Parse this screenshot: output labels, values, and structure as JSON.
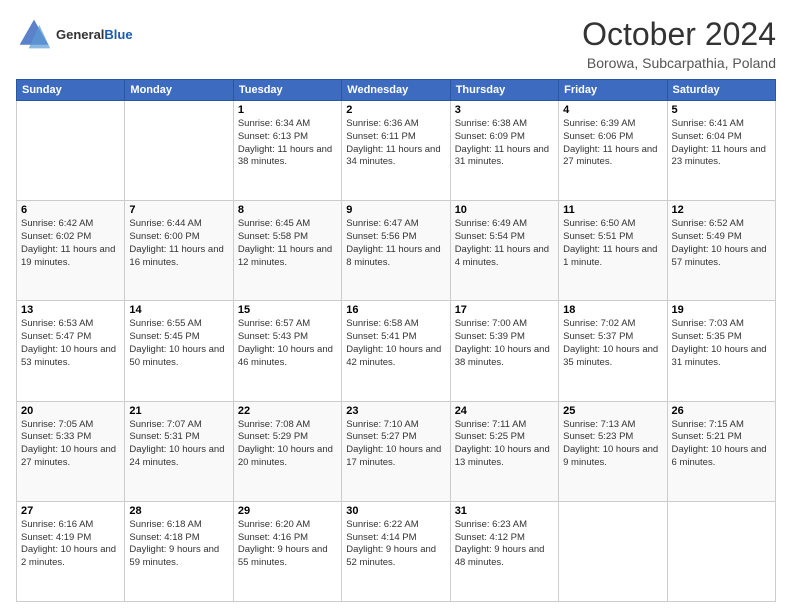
{
  "header": {
    "logo_general": "General",
    "logo_blue": "Blue",
    "month": "October 2024",
    "location": "Borowa, Subcarpathia, Poland"
  },
  "days_of_week": [
    "Sunday",
    "Monday",
    "Tuesday",
    "Wednesday",
    "Thursday",
    "Friday",
    "Saturday"
  ],
  "weeks": [
    [
      {
        "day": "",
        "sunrise": "",
        "sunset": "",
        "daylight": ""
      },
      {
        "day": "",
        "sunrise": "",
        "sunset": "",
        "daylight": ""
      },
      {
        "day": "1",
        "sunrise": "Sunrise: 6:34 AM",
        "sunset": "Sunset: 6:13 PM",
        "daylight": "Daylight: 11 hours and 38 minutes."
      },
      {
        "day": "2",
        "sunrise": "Sunrise: 6:36 AM",
        "sunset": "Sunset: 6:11 PM",
        "daylight": "Daylight: 11 hours and 34 minutes."
      },
      {
        "day": "3",
        "sunrise": "Sunrise: 6:38 AM",
        "sunset": "Sunset: 6:09 PM",
        "daylight": "Daylight: 11 hours and 31 minutes."
      },
      {
        "day": "4",
        "sunrise": "Sunrise: 6:39 AM",
        "sunset": "Sunset: 6:06 PM",
        "daylight": "Daylight: 11 hours and 27 minutes."
      },
      {
        "day": "5",
        "sunrise": "Sunrise: 6:41 AM",
        "sunset": "Sunset: 6:04 PM",
        "daylight": "Daylight: 11 hours and 23 minutes."
      }
    ],
    [
      {
        "day": "6",
        "sunrise": "Sunrise: 6:42 AM",
        "sunset": "Sunset: 6:02 PM",
        "daylight": "Daylight: 11 hours and 19 minutes."
      },
      {
        "day": "7",
        "sunrise": "Sunrise: 6:44 AM",
        "sunset": "Sunset: 6:00 PM",
        "daylight": "Daylight: 11 hours and 16 minutes."
      },
      {
        "day": "8",
        "sunrise": "Sunrise: 6:45 AM",
        "sunset": "Sunset: 5:58 PM",
        "daylight": "Daylight: 11 hours and 12 minutes."
      },
      {
        "day": "9",
        "sunrise": "Sunrise: 6:47 AM",
        "sunset": "Sunset: 5:56 PM",
        "daylight": "Daylight: 11 hours and 8 minutes."
      },
      {
        "day": "10",
        "sunrise": "Sunrise: 6:49 AM",
        "sunset": "Sunset: 5:54 PM",
        "daylight": "Daylight: 11 hours and 4 minutes."
      },
      {
        "day": "11",
        "sunrise": "Sunrise: 6:50 AM",
        "sunset": "Sunset: 5:51 PM",
        "daylight": "Daylight: 11 hours and 1 minute."
      },
      {
        "day": "12",
        "sunrise": "Sunrise: 6:52 AM",
        "sunset": "Sunset: 5:49 PM",
        "daylight": "Daylight: 10 hours and 57 minutes."
      }
    ],
    [
      {
        "day": "13",
        "sunrise": "Sunrise: 6:53 AM",
        "sunset": "Sunset: 5:47 PM",
        "daylight": "Daylight: 10 hours and 53 minutes."
      },
      {
        "day": "14",
        "sunrise": "Sunrise: 6:55 AM",
        "sunset": "Sunset: 5:45 PM",
        "daylight": "Daylight: 10 hours and 50 minutes."
      },
      {
        "day": "15",
        "sunrise": "Sunrise: 6:57 AM",
        "sunset": "Sunset: 5:43 PM",
        "daylight": "Daylight: 10 hours and 46 minutes."
      },
      {
        "day": "16",
        "sunrise": "Sunrise: 6:58 AM",
        "sunset": "Sunset: 5:41 PM",
        "daylight": "Daylight: 10 hours and 42 minutes."
      },
      {
        "day": "17",
        "sunrise": "Sunrise: 7:00 AM",
        "sunset": "Sunset: 5:39 PM",
        "daylight": "Daylight: 10 hours and 38 minutes."
      },
      {
        "day": "18",
        "sunrise": "Sunrise: 7:02 AM",
        "sunset": "Sunset: 5:37 PM",
        "daylight": "Daylight: 10 hours and 35 minutes."
      },
      {
        "day": "19",
        "sunrise": "Sunrise: 7:03 AM",
        "sunset": "Sunset: 5:35 PM",
        "daylight": "Daylight: 10 hours and 31 minutes."
      }
    ],
    [
      {
        "day": "20",
        "sunrise": "Sunrise: 7:05 AM",
        "sunset": "Sunset: 5:33 PM",
        "daylight": "Daylight: 10 hours and 27 minutes."
      },
      {
        "day": "21",
        "sunrise": "Sunrise: 7:07 AM",
        "sunset": "Sunset: 5:31 PM",
        "daylight": "Daylight: 10 hours and 24 minutes."
      },
      {
        "day": "22",
        "sunrise": "Sunrise: 7:08 AM",
        "sunset": "Sunset: 5:29 PM",
        "daylight": "Daylight: 10 hours and 20 minutes."
      },
      {
        "day": "23",
        "sunrise": "Sunrise: 7:10 AM",
        "sunset": "Sunset: 5:27 PM",
        "daylight": "Daylight: 10 hours and 17 minutes."
      },
      {
        "day": "24",
        "sunrise": "Sunrise: 7:11 AM",
        "sunset": "Sunset: 5:25 PM",
        "daylight": "Daylight: 10 hours and 13 minutes."
      },
      {
        "day": "25",
        "sunrise": "Sunrise: 7:13 AM",
        "sunset": "Sunset: 5:23 PM",
        "daylight": "Daylight: 10 hours and 9 minutes."
      },
      {
        "day": "26",
        "sunrise": "Sunrise: 7:15 AM",
        "sunset": "Sunset: 5:21 PM",
        "daylight": "Daylight: 10 hours and 6 minutes."
      }
    ],
    [
      {
        "day": "27",
        "sunrise": "Sunrise: 6:16 AM",
        "sunset": "Sunset: 4:19 PM",
        "daylight": "Daylight: 10 hours and 2 minutes."
      },
      {
        "day": "28",
        "sunrise": "Sunrise: 6:18 AM",
        "sunset": "Sunset: 4:18 PM",
        "daylight": "Daylight: 9 hours and 59 minutes."
      },
      {
        "day": "29",
        "sunrise": "Sunrise: 6:20 AM",
        "sunset": "Sunset: 4:16 PM",
        "daylight": "Daylight: 9 hours and 55 minutes."
      },
      {
        "day": "30",
        "sunrise": "Sunrise: 6:22 AM",
        "sunset": "Sunset: 4:14 PM",
        "daylight": "Daylight: 9 hours and 52 minutes."
      },
      {
        "day": "31",
        "sunrise": "Sunrise: 6:23 AM",
        "sunset": "Sunset: 4:12 PM",
        "daylight": "Daylight: 9 hours and 48 minutes."
      },
      {
        "day": "",
        "sunrise": "",
        "sunset": "",
        "daylight": ""
      },
      {
        "day": "",
        "sunrise": "",
        "sunset": "",
        "daylight": ""
      }
    ]
  ]
}
